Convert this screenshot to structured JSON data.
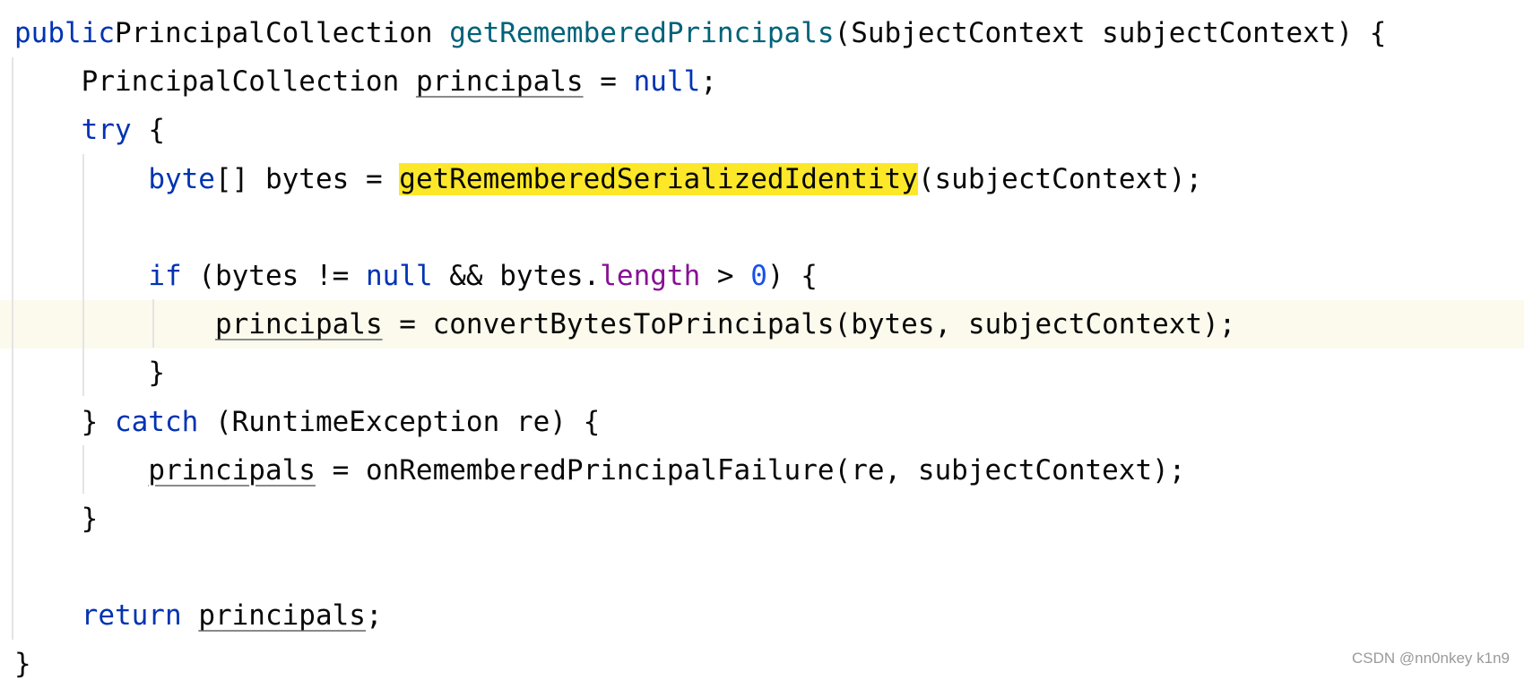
{
  "editor": {
    "lines": [
      {
        "indent": 0,
        "tokens": [
          [
            "kw",
            "public"
          ],
          [
            "",
            "PrincipalCollection "
          ],
          [
            "fn-decl",
            "getRememberedPrincipals"
          ],
          [
            "",
            "(SubjectContext subjectContext) {"
          ]
        ]
      },
      {
        "indent": 1,
        "tokens": [
          [
            "",
            "PrincipalCollection "
          ],
          [
            "var-mut",
            "principals"
          ],
          [
            "",
            " = "
          ],
          [
            "kw",
            "null"
          ],
          [
            "",
            ";"
          ]
        ]
      },
      {
        "indent": 1,
        "tokens": [
          [
            "kw",
            "try"
          ],
          [
            "",
            " {"
          ]
        ]
      },
      {
        "indent": 2,
        "tokens": [
          [
            "kw",
            "byte"
          ],
          [
            "",
            "[] bytes = "
          ],
          [
            "hl",
            "getRememberedSerializedIdentity"
          ],
          [
            "",
            "(subjectContext);"
          ]
        ]
      },
      {
        "indent": 0,
        "tokens": []
      },
      {
        "indent": 2,
        "tokens": [
          [
            "kw",
            "if"
          ],
          [
            "",
            " (bytes != "
          ],
          [
            "kw",
            "null"
          ],
          [
            "",
            " && bytes."
          ],
          [
            "field",
            "length"
          ],
          [
            "",
            " > "
          ],
          [
            "num",
            "0"
          ],
          [
            "",
            ") {"
          ]
        ]
      },
      {
        "indent": 3,
        "current": true,
        "tokens": [
          [
            "var-mut",
            "principals"
          ],
          [
            "",
            " = convertBytesToPrincipals(bytes, subjectContext);"
          ]
        ]
      },
      {
        "indent": 2,
        "tokens": [
          [
            "",
            "}"
          ]
        ]
      },
      {
        "indent": 1,
        "tokens": [
          [
            "",
            "} "
          ],
          [
            "kw",
            "catch"
          ],
          [
            "",
            " (RuntimeException re) {"
          ]
        ]
      },
      {
        "indent": 2,
        "tokens": [
          [
            "var-mut",
            "principals"
          ],
          [
            "",
            " = onRememberedPrincipalFailure(re, subjectContext);"
          ]
        ]
      },
      {
        "indent": 1,
        "tokens": [
          [
            "",
            "}"
          ]
        ]
      },
      {
        "indent": 0,
        "tokens": []
      },
      {
        "indent": 1,
        "tokens": [
          [
            "kw",
            "return"
          ],
          [
            " ",
            ""
          ],
          [
            "var-mut",
            "principals"
          ],
          [
            "",
            ";"
          ]
        ]
      },
      {
        "indent": 0,
        "tokens": [
          [
            "",
            "}"
          ]
        ]
      }
    ]
  },
  "watermark": "CSDN @nn0nkey k1n9",
  "colors": {
    "keyword": "#0033b3",
    "method_declaration": "#00627a",
    "field": "#871094",
    "number": "#1750eb",
    "highlight": "#fce828",
    "current_line": "#fcfaed"
  }
}
